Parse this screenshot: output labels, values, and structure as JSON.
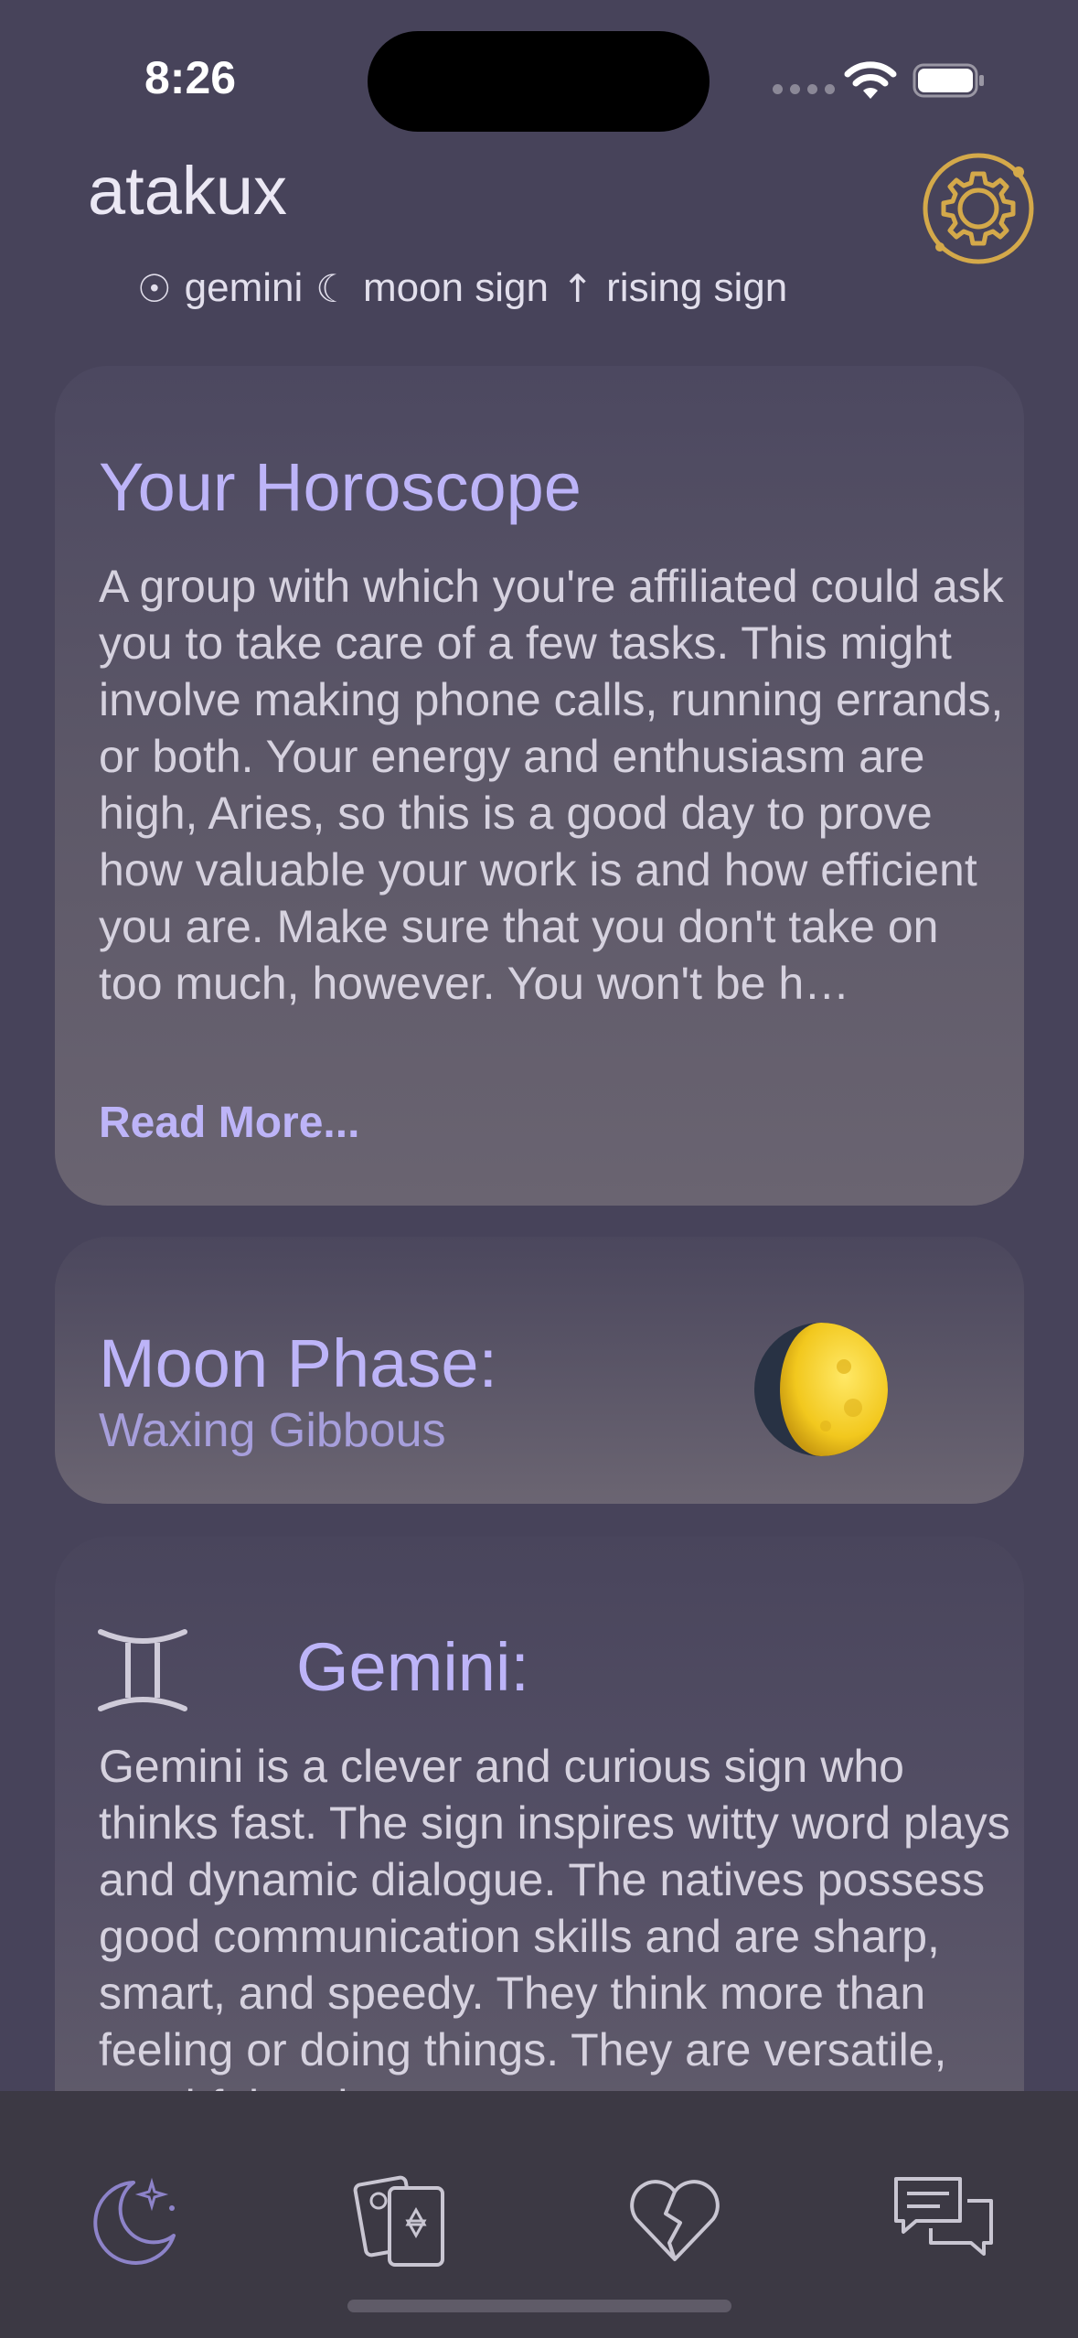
{
  "status_bar": {
    "time": "8:26"
  },
  "header": {
    "username": "atakux",
    "sun_sign": "gemini",
    "moon_sign": "moon sign",
    "rising_sign": "rising sign"
  },
  "horoscope_card": {
    "title": "Your Horoscope",
    "text": " A group with which you're affiliated could ask you to take care of a few tasks. This might involve making phone calls, running errands, or both. Your energy and enthusiasm are high, Aries, so this is a good day to prove how valuable your work is and how efficient you are. Make sure that you don't take on too much, however. You won't be h…",
    "read_more_label": "Read More..."
  },
  "moon_card": {
    "title": "Moon Phase:",
    "phase_name": "Waxing Gibbous"
  },
  "sign_card": {
    "title": "Gemini:",
    "text": "Gemini is a clever and curious sign who thinks fast. The sign inspires witty word plays and dynamic dialogue. The natives possess good communication skills and are sharp, smart, and speedy. They think more than feeling or doing things. They are versatile, youthful and"
  },
  "tab_bar": {
    "tabs": [
      {
        "icon": "moon-stars-icon"
      },
      {
        "icon": "tarot-cards-icon"
      },
      {
        "icon": "broken-heart-icon"
      },
      {
        "icon": "chat-bubbles-icon"
      }
    ]
  },
  "colors": {
    "background": "#47435a",
    "accent": "#bdb4f8",
    "settings_gold": "#d4a94a",
    "tab_bar": "#3c3944"
  }
}
